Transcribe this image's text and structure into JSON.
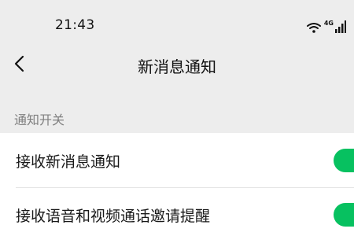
{
  "status_bar": {
    "time": "21:43",
    "network_label": "4G",
    "icons": [
      "wifi-icon",
      "cellular-signal-icon"
    ]
  },
  "nav": {
    "back_icon": "chevron-left-icon",
    "title": "新消息通知"
  },
  "section": {
    "title": "通知开关"
  },
  "settings": [
    {
      "label": "接收新消息通知",
      "enabled": true
    },
    {
      "label": "接收语音和视频通话邀请提醒",
      "enabled": true
    }
  ],
  "colors": {
    "background": "#ededed",
    "card": "#ffffff",
    "accent": "#07c160",
    "secondary_text": "#7f7f7f"
  }
}
